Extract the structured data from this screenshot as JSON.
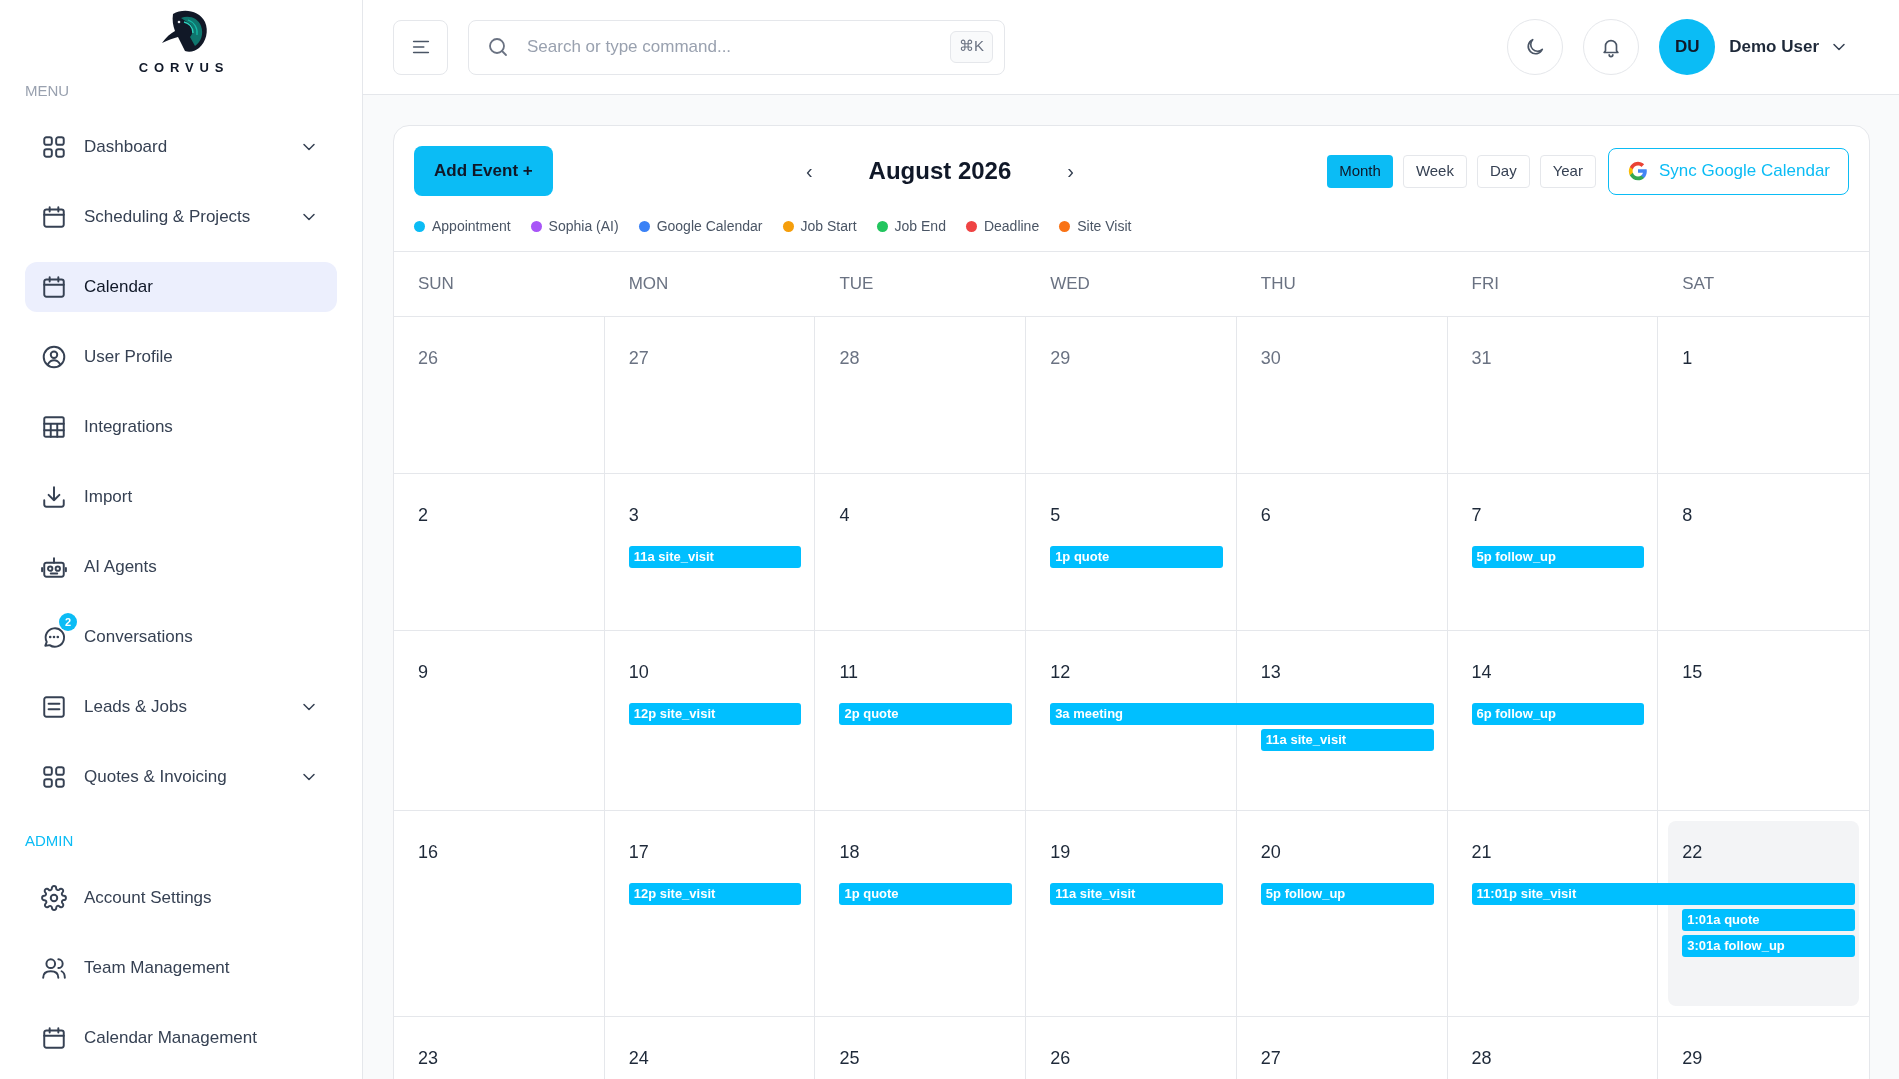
{
  "brand": {
    "name": "CORVUS"
  },
  "sidebar": {
    "sections": [
      {
        "title": "MENU",
        "kind": "menu",
        "items": [
          {
            "label": "Dashboard",
            "expandable": true,
            "selected": false
          },
          {
            "label": "Scheduling & Projects",
            "expandable": true,
            "selected": false
          },
          {
            "label": "Calendar",
            "expandable": false,
            "selected": true
          },
          {
            "label": "User Profile",
            "expandable": false,
            "selected": false
          },
          {
            "label": "Integrations",
            "expandable": false,
            "selected": false
          },
          {
            "label": "Import",
            "expandable": false,
            "selected": false
          },
          {
            "label": "AI Agents",
            "expandable": false,
            "selected": false
          },
          {
            "label": "Conversations",
            "expandable": false,
            "selected": false,
            "badge": "2"
          },
          {
            "label": "Leads & Jobs",
            "expandable": true,
            "selected": false
          },
          {
            "label": "Quotes & Invoicing",
            "expandable": true,
            "selected": false
          }
        ]
      },
      {
        "title": "ADMIN",
        "kind": "admin",
        "items": [
          {
            "label": "Account Settings",
            "expandable": false,
            "selected": false
          },
          {
            "label": "Team Management",
            "expandable": false,
            "selected": false
          },
          {
            "label": "Calendar Management",
            "expandable": false,
            "selected": false
          }
        ]
      }
    ]
  },
  "header": {
    "search": {
      "placeholder": "Search or type command...",
      "shortcut": "⌘K"
    },
    "user": {
      "initials": "DU",
      "name": "Demo User"
    }
  },
  "calendar": {
    "add_button": "Add Event +",
    "prev": "‹",
    "next": "›",
    "title": "August 2026",
    "views": [
      {
        "label": "Month",
        "selected": true
      },
      {
        "label": "Week",
        "selected": false
      },
      {
        "label": "Day",
        "selected": false
      },
      {
        "label": "Year",
        "selected": false
      }
    ],
    "sync_button": "Sync Google Calendar",
    "legend": [
      {
        "label": "Appointment",
        "color": "#0bbcf5"
      },
      {
        "label": "Sophia (AI)",
        "color": "#a855f7"
      },
      {
        "label": "Google Calendar",
        "color": "#3b82f6"
      },
      {
        "label": "Job Start",
        "color": "#f59e0b"
      },
      {
        "label": "Job End",
        "color": "#22c55e"
      },
      {
        "label": "Deadline",
        "color": "#ef4444"
      },
      {
        "label": "Site Visit",
        "color": "#f97316"
      }
    ],
    "weekdays": [
      "SUN",
      "MON",
      "TUE",
      "WED",
      "THU",
      "FRI",
      "SAT"
    ],
    "weeks": [
      {
        "days": [
          {
            "label": "26",
            "in_month": false,
            "highlighted": false
          },
          {
            "label": "27",
            "in_month": false,
            "highlighted": false
          },
          {
            "label": "28",
            "in_month": false,
            "highlighted": false
          },
          {
            "label": "29",
            "in_month": false,
            "highlighted": false
          },
          {
            "label": "30",
            "in_month": false,
            "highlighted": false
          },
          {
            "label": "31",
            "in_month": false,
            "highlighted": false
          },
          {
            "label": "1",
            "in_month": true,
            "highlighted": false
          }
        ]
      },
      {
        "days": [
          {
            "label": "2",
            "in_month": true,
            "highlighted": false
          },
          {
            "label": "3",
            "in_month": true,
            "highlighted": false,
            "events": [
              {
                "label": "11a site_visit",
                "continues": false
              }
            ]
          },
          {
            "label": "4",
            "in_month": true,
            "highlighted": false
          },
          {
            "label": "5",
            "in_month": true,
            "highlighted": false,
            "events": [
              {
                "label": "1p quote",
                "continues": false
              }
            ]
          },
          {
            "label": "6",
            "in_month": true,
            "highlighted": false
          },
          {
            "label": "7",
            "in_month": true,
            "highlighted": false,
            "events": [
              {
                "label": "5p follow_up",
                "continues": false
              }
            ]
          },
          {
            "label": "8",
            "in_month": true,
            "highlighted": false
          }
        ]
      },
      {
        "days": [
          {
            "label": "9",
            "in_month": true,
            "highlighted": false
          },
          {
            "label": "10",
            "in_month": true,
            "highlighted": false,
            "events": [
              {
                "label": "12p site_visit",
                "continues": false
              }
            ]
          },
          {
            "label": "11",
            "in_month": true,
            "highlighted": false,
            "events": [
              {
                "label": "2p quote",
                "continues": false
              }
            ]
          },
          {
            "label": "12",
            "in_month": true,
            "highlighted": false,
            "events": [
              {
                "label": "3a meeting",
                "continues": true
              }
            ]
          },
          {
            "label": "13",
            "in_month": true,
            "highlighted": false,
            "events": [
              {
                "label": "11a site_visit",
                "continues": false
              }
            ]
          },
          {
            "label": "14",
            "in_month": true,
            "highlighted": false,
            "events": [
              {
                "label": "6p follow_up",
                "continues": false
              }
            ]
          },
          {
            "label": "15",
            "in_month": true,
            "highlighted": false
          }
        ]
      },
      {
        "days": [
          {
            "label": "16",
            "in_month": true,
            "highlighted": false
          },
          {
            "label": "17",
            "in_month": true,
            "highlighted": false,
            "events": [
              {
                "label": "12p site_visit",
                "continues": false
              }
            ]
          },
          {
            "label": "18",
            "in_month": true,
            "highlighted": false,
            "events": [
              {
                "label": "1p quote",
                "continues": false
              }
            ]
          },
          {
            "label": "19",
            "in_month": true,
            "highlighted": false,
            "events": [
              {
                "label": "11a site_visit",
                "continues": false
              }
            ]
          },
          {
            "label": "20",
            "in_month": true,
            "highlighted": false,
            "events": [
              {
                "label": "5p follow_up",
                "continues": false
              }
            ]
          },
          {
            "label": "21",
            "in_month": true,
            "highlighted": false,
            "events": [
              {
                "label": "11:01p site_visit",
                "continues": true
              }
            ]
          },
          {
            "label": "22",
            "in_month": true,
            "highlighted": true,
            "events": [
              {
                "label": "1:01a quote",
                "continues": false
              },
              {
                "label": "3:01a follow_up",
                "continues": false
              }
            ]
          }
        ]
      },
      {
        "days": [
          {
            "label": "23",
            "in_month": true,
            "highlighted": false
          },
          {
            "label": "24",
            "in_month": true,
            "highlighted": false
          },
          {
            "label": "25",
            "in_month": true,
            "highlighted": false
          },
          {
            "label": "26",
            "in_month": true,
            "highlighted": false
          },
          {
            "label": "27",
            "in_month": true,
            "highlighted": false
          },
          {
            "label": "28",
            "in_month": true,
            "highlighted": false
          },
          {
            "label": "29",
            "in_month": true,
            "highlighted": false
          }
        ]
      }
    ]
  }
}
